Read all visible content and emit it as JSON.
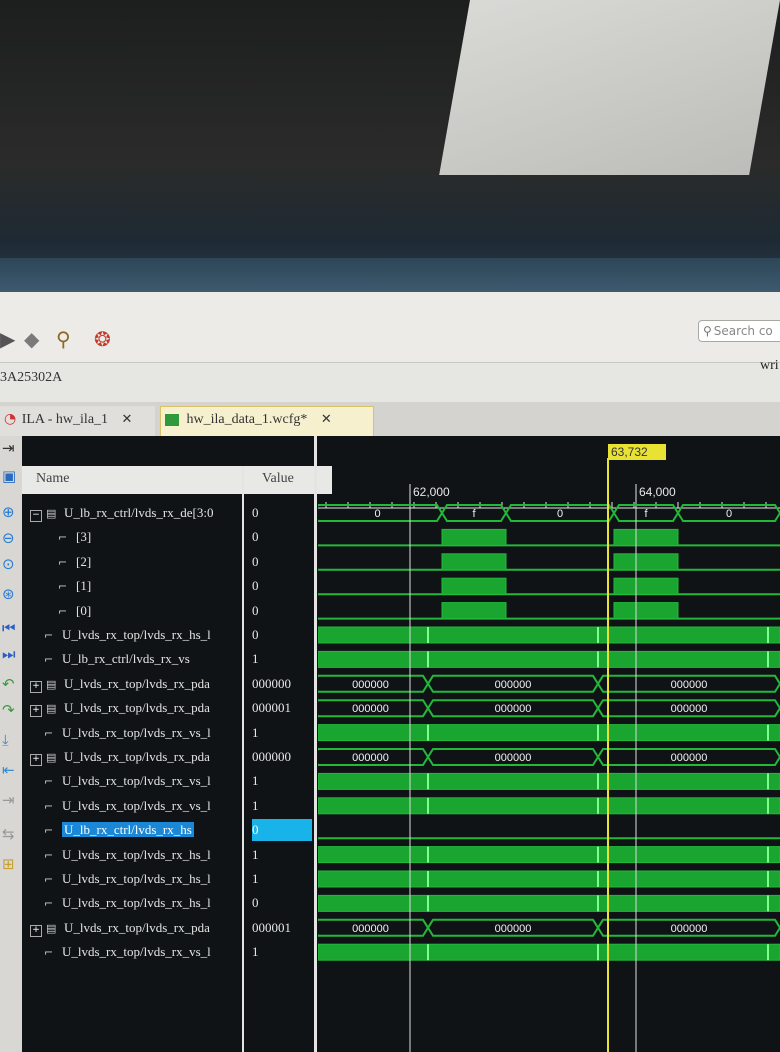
{
  "toolbar": {
    "search_placeholder": "Search co",
    "device_label": "3A25302A",
    "right_text": "wri"
  },
  "tabs": [
    {
      "label": "ILA - hw_ila_1",
      "active": false
    },
    {
      "label": "hw_ila_data_1.wcfg*",
      "active": true
    }
  ],
  "tab_close_glyph": "✕",
  "columns": {
    "name": "Name",
    "value": "Value"
  },
  "cursor": {
    "label": "63,732",
    "color": "#e8e233"
  },
  "ruler": {
    "labels": [
      "62,000",
      "64,000"
    ]
  },
  "signals": [
    {
      "name": "U_lb_rx_ctrl/lvds_rx_de[3:0",
      "value": "0",
      "kind": "bus",
      "expanded": true,
      "indent": 0
    },
    {
      "name": "[3]",
      "value": "0",
      "kind": "bit",
      "indent": 2
    },
    {
      "name": "[2]",
      "value": "0",
      "kind": "bit",
      "indent": 2
    },
    {
      "name": "[1]",
      "value": "0",
      "kind": "bit",
      "indent": 2
    },
    {
      "name": "[0]",
      "value": "0",
      "kind": "bit",
      "indent": 2
    },
    {
      "name": "U_lvds_rx_top/lvds_rx_hs_l",
      "value": "0",
      "kind": "bit",
      "indent": 1
    },
    {
      "name": "U_lb_rx_ctrl/lvds_rx_vs",
      "value": "1",
      "kind": "bit",
      "indent": 1
    },
    {
      "name": "U_lvds_rx_top/lvds_rx_pda",
      "value": "000000",
      "kind": "bus",
      "expanded": false,
      "indent": 0
    },
    {
      "name": "U_lvds_rx_top/lvds_rx_pda",
      "value": "000001",
      "kind": "bus",
      "expanded": false,
      "indent": 0
    },
    {
      "name": "U_lvds_rx_top/lvds_rx_vs_l",
      "value": "1",
      "kind": "bit",
      "indent": 1
    },
    {
      "name": "U_lvds_rx_top/lvds_rx_pda",
      "value": "000000",
      "kind": "bus",
      "expanded": false,
      "indent": 0
    },
    {
      "name": "U_lvds_rx_top/lvds_rx_vs_l",
      "value": "1",
      "kind": "bit",
      "indent": 1
    },
    {
      "name": "U_lvds_rx_top/lvds_rx_vs_l",
      "value": "1",
      "kind": "bit",
      "indent": 1
    },
    {
      "name": "U_lb_rx_ctrl/lvds_rx_hs",
      "value": "0",
      "kind": "bit",
      "indent": 1,
      "selected": true
    },
    {
      "name": "U_lvds_rx_top/lvds_rx_hs_l",
      "value": "1",
      "kind": "bit",
      "indent": 1
    },
    {
      "name": "U_lvds_rx_top/lvds_rx_hs_l",
      "value": "1",
      "kind": "bit",
      "indent": 1
    },
    {
      "name": "U_lvds_rx_top/lvds_rx_hs_l",
      "value": "0",
      "kind": "bit",
      "indent": 1
    },
    {
      "name": "U_lvds_rx_top/lvds_rx_pda",
      "value": "000001",
      "kind": "bus",
      "expanded": false,
      "indent": 0
    },
    {
      "name": "U_lvds_rx_top/lvds_rx_vs_l",
      "value": "1",
      "kind": "bit",
      "indent": 1
    }
  ],
  "bus_traces": {
    "0": [
      "0",
      "f",
      "0",
      "f",
      "0"
    ],
    "7": [
      "000000",
      "000000",
      "000000"
    ],
    "8": [
      "000000",
      "000000",
      "000000"
    ],
    "10": [
      "000000",
      "000000",
      "000000"
    ],
    "17": [
      "000000",
      "000000",
      "000000"
    ]
  },
  "colors": {
    "wave": "#22b83a",
    "wave_fill": "#19a52f",
    "bg": "#101316",
    "cursor": "#e8e233"
  }
}
